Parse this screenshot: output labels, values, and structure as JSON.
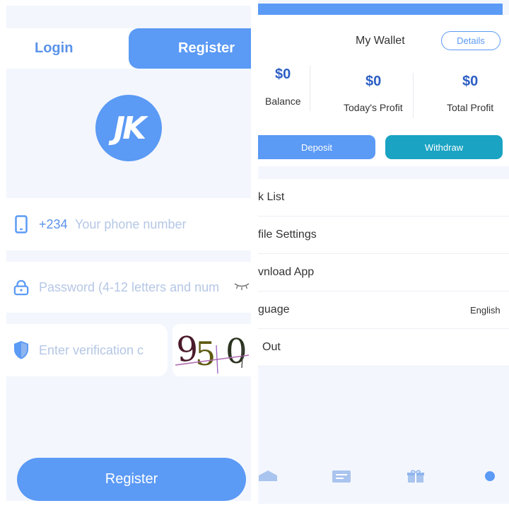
{
  "login_screen": {
    "tabs": {
      "login": "Login",
      "register": "Register"
    },
    "logo_text": "JK",
    "phone_prefix": "+234",
    "phone_placeholder": "Your phone number",
    "password_placeholder": "Password (4-12 letters and num",
    "verification_placeholder": "Enter verification c",
    "captcha_text": "950",
    "register_button": "Register",
    "colors": {
      "primary": "#5b9af5",
      "background": "#f3f6fd",
      "placeholder": "#b5c7e6"
    },
    "icons": [
      "phone-icon",
      "lock-icon",
      "shield-icon",
      "eye-closed-icon"
    ]
  },
  "wallet_screen": {
    "title": "My Wallet",
    "details_button": "Details",
    "stats": [
      {
        "value": "$0",
        "label": "Balance"
      },
      {
        "value": "$0",
        "label": "Today's Profit"
      },
      {
        "value": "$0",
        "label": "Total Profit"
      }
    ],
    "deposit_button": "Deposit",
    "withdraw_button": "Withdraw",
    "menu": [
      {
        "label": "k List",
        "value": ""
      },
      {
        "label": "file Settings",
        "value": ""
      },
      {
        "label": "vnload App",
        "value": ""
      },
      {
        "label": "guage",
        "value": "English"
      },
      {
        "label": "Out",
        "value": ""
      }
    ],
    "colors": {
      "stat_value": "#2d5fc4",
      "withdraw": "#1aa3c2"
    },
    "bottom_nav_icons": [
      "home-icon",
      "orders-icon",
      "gift-icon",
      "profile-icon"
    ]
  }
}
